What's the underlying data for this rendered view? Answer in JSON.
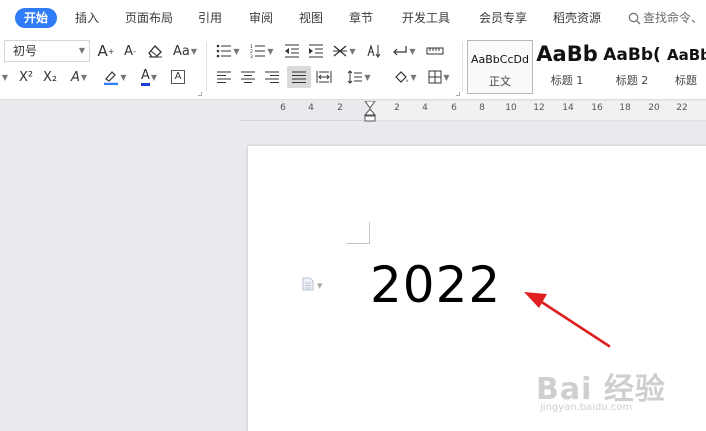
{
  "menu": {
    "tabs": [
      {
        "label": "开始"
      },
      {
        "label": "插入"
      },
      {
        "label": "页面布局"
      },
      {
        "label": "引用"
      },
      {
        "label": "审阅"
      },
      {
        "label": "视图"
      },
      {
        "label": "章节"
      },
      {
        "label": "开发工具"
      },
      {
        "label": "会员专享"
      },
      {
        "label": "稻壳资源"
      }
    ],
    "search_label": "查找命令、"
  },
  "ribbon": {
    "font_size_value": "初号",
    "grow_font_label": "A",
    "shrink_font_label": "A",
    "change_case_label": "Aa",
    "superscript_label": "X²",
    "subscript_label": "X₂",
    "text_effect_label": "A",
    "font_color_label": "A",
    "char_border_label": "A",
    "styles": [
      {
        "sample": "AaBbCcDd",
        "name": "正文"
      },
      {
        "sample": "AaBb",
        "name": "标题 1"
      },
      {
        "sample": "AaBb(",
        "name": "标题 2"
      },
      {
        "sample": "AaBb",
        "name": "标题"
      }
    ]
  },
  "ruler": {
    "ticks": [
      "6",
      "4",
      "2",
      "2",
      "4",
      "6",
      "8",
      "10",
      "12",
      "14",
      "16",
      "18",
      "20",
      "22"
    ]
  },
  "document": {
    "text": "2022"
  },
  "watermark": {
    "logo": "Bai 经验",
    "subtitle": "jingyan.baidu.com"
  },
  "colors": {
    "accent": "#2f7cf6",
    "highlight_underline": "#2f7cf6",
    "font_color_underline": "#1a3fd6",
    "annotation_arrow": "#e02020"
  }
}
